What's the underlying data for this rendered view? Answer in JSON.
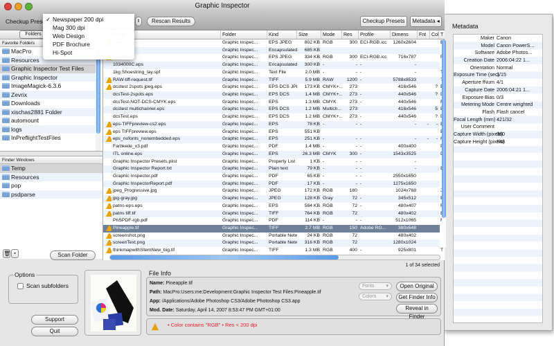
{
  "window": {
    "title": "Graphic Inspector"
  },
  "toolbar": {
    "preset_label": "Checkup Prese",
    "rescan": "Rescan Results",
    "checkup_presets": "Checkup Presets",
    "metadata": "Metadata"
  },
  "preset_menu": {
    "checkmark": "✓",
    "items": [
      "Newspaper 200 dpi",
      "Mag 300 dpi",
      "Web Design",
      "PDF Brochure",
      "Hi-Spot"
    ],
    "selected": "Newspaper 200 dpi"
  },
  "left": {
    "folders_tab": "Folders",
    "favorites_header": "Favorite Folders",
    "favorites": [
      "MacPro",
      "Resources",
      "Graphic Inspector Test Files",
      "Graphic Inspector",
      "ImageMagick-6.3.6",
      "Zevrix",
      "Downloads",
      "xischas2881 Folder",
      "automount",
      "logs",
      "InPreflightTestFiles"
    ],
    "favorites_selected": "Graphic Inspector Test Files",
    "finder_header": "Finder Windows",
    "finder": [
      "Temp",
      "Resources",
      "pop",
      "psdparse"
    ],
    "finder_selected": "Temp",
    "scan_folder": "Scan Folder"
  },
  "table": {
    "columns": [
      "",
      "Name",
      "Folder",
      "Kind",
      "Size",
      "Mode",
      "Res",
      "Profile",
      "Dimens",
      "Fnt",
      "Col",
      "T"
    ],
    "rows": [
      {
        "warn": true,
        "name": "...eps",
        "folder": "Graphic Inspec...",
        "kind": "EPS JPEG",
        "size": "802 KB",
        "mode": "RGB",
        "res": "300",
        "profile": "ECI-RGB.icc",
        "dim": "1260x2604",
        "fnt": "",
        "col": "",
        "t": "E"
      },
      {
        "warn": false,
        "name": "",
        "folder": "Graphic Inspec...",
        "kind": "Encapsulated P...",
        "size": "685 KB",
        "mode": "",
        "res": "",
        "profile": "",
        "dim": "",
        "fnt": "",
        "col": "",
        "t": ""
      },
      {
        "warn": true,
        "name": "...test.eps",
        "folder": "Graphic Inspec...",
        "kind": "EPS JPEG",
        "size": "334 KB",
        "mode": "RGB",
        "res": "300",
        "profile": "ECI-RGB.icc",
        "dim": "716x787",
        "fnt": "",
        "col": "",
        "t": "F"
      },
      {
        "warn": false,
        "name": "1034000C.eps",
        "folder": "Graphic Inspec...",
        "kind": "Encapsulated P...",
        "size": "300 KB",
        "mode": "-",
        "res": "-",
        "profile": "-",
        "dim": "-",
        "fnt": "",
        "col": "",
        "t": ""
      },
      {
        "warn": false,
        "name": "1kg Shoestring_lay.spf",
        "folder": "Graphic Inspec...",
        "kind": "Text File",
        "size": "2.0 MB",
        "mode": "-",
        "res": "-",
        "profile": "-",
        "dim": "-",
        "fnt": "",
        "col": "",
        "t": "T"
      },
      {
        "warn": true,
        "name": "RAW-tiff-request.tif",
        "folder": "Graphic Inspec...",
        "kind": "TIFF",
        "size": "5.9 MB",
        "mode": "RAW",
        "res": "1200",
        "profile": "-",
        "dim": "5788x8533",
        "fnt": "",
        "col": "",
        "t": "T"
      },
      {
        "warn": true,
        "name": "dcstest 2spots jpeg.eps",
        "folder": "Graphic Inspec...",
        "kind": "EPS DCS JPEG",
        "size": "173 KB",
        "mode": "CMYK+...",
        "res": "273",
        "profile": "",
        "dim": "416x546",
        "fnt": "",
        "col": "?",
        "t": "E"
      },
      {
        "warn": false,
        "name": "dcsTest-2spots.eps",
        "folder": "Graphic Inspec...",
        "kind": "EPS DCS",
        "size": "1.4 MB",
        "mode": "CMYK+...",
        "res": "273",
        "profile": "-",
        "dim": "440x546",
        "fnt": "",
        "col": "?",
        "t": "D"
      },
      {
        "warn": false,
        "name": "dcsTest-NOT-DCS-CMYK.eps",
        "folder": "Graphic Inspec...",
        "kind": "EPS",
        "size": "1.3 MB",
        "mode": "CMYK",
        "res": "273",
        "profile": "-",
        "dim": "440x546",
        "fnt": "",
        "col": "",
        "t": "F"
      },
      {
        "warn": false,
        "name": "dcstest multichannel.eps",
        "folder": "Graphic Inspec...",
        "kind": "EPS DCS",
        "size": "1.2 MB",
        "mode": "Multich...",
        "res": "273",
        "profile": "",
        "dim": "416x546",
        "fnt": "",
        "col": "5",
        "t": "E"
      },
      {
        "warn": false,
        "name": "dcsTest.eps",
        "folder": "Graphic Inspec...",
        "kind": "EPS DCS",
        "size": "1.2 MB",
        "mode": "CMYK+...",
        "res": "273",
        "profile": "-",
        "dim": "440x546",
        "fnt": "",
        "col": "?",
        "t": "D"
      },
      {
        "warn": true,
        "name": "eps-TIFFpreview-cs2.eps",
        "folder": "Graphic Inspec...",
        "kind": "EPS",
        "size": "78 KB",
        "mode": "-",
        "res": "-",
        "profile": "-",
        "dim": "-",
        "fnt": "-",
        "col": "-",
        "t": "E"
      },
      {
        "warn": true,
        "name": "eps TIFFpreview.eps",
        "folder": "Graphic Inspec...",
        "kind": "EPS",
        "size": "551 KB",
        "mode": "",
        "res": "",
        "profile": "",
        "dim": "",
        "fnt": "",
        "col": "",
        "t": "E"
      },
      {
        "warn": true,
        "name": "eps_nofonts_nonembedded.eps",
        "folder": "Graphic Inspec...",
        "kind": "EPS",
        "size": "251 KB",
        "mode": "-",
        "res": "-",
        "profile": "-",
        "dim": "-",
        "fnt": "-",
        "col": "-",
        "t": "F"
      },
      {
        "warn": false,
        "name": "Farbkeile_x3.pdf",
        "folder": "Graphic Inspec...",
        "kind": "PDF",
        "size": "1.4 MB",
        "mode": "-",
        "res": "-",
        "profile": "-",
        "dim": "400x400",
        "fnt": "",
        "col": "",
        "t": "P"
      },
      {
        "warn": false,
        "name": "ITL online.eps",
        "folder": "Graphic Inspec...",
        "kind": "EPS",
        "size": "26.3 MB",
        "mode": "CMYK",
        "res": "300",
        "profile": "-",
        "dim": "1543x3525",
        "fnt": "",
        "col": "",
        "t": "D"
      },
      {
        "warn": false,
        "name": "Graphic Inspector Presets.plist",
        "folder": "Graphic Inspec...",
        "kind": "Property List",
        "size": "1 KB",
        "mode": "-",
        "res": "-",
        "profile": "-",
        "dim": "-",
        "fnt": "",
        "col": "",
        "t": ""
      },
      {
        "warn": false,
        "name": "Graphic Inspector Report.txt",
        "folder": "Graphic Inspec...",
        "kind": "Plain text",
        "size": "79 KB",
        "mode": "-",
        "res": "-",
        "profile": "-",
        "dim": "-",
        "fnt": "",
        "col": "",
        "t": "E"
      },
      {
        "warn": false,
        "name": "Graphic Inspector.pdf",
        "folder": "Graphic Inspec...",
        "kind": "PDF",
        "size": "65 KB",
        "mode": "-",
        "res": "-",
        "profile": "-",
        "dim": "2550x1650",
        "fnt": "",
        "col": "",
        "t": ""
      },
      {
        "warn": false,
        "name": "Graphic InspectorReport.pdf",
        "folder": "Graphic Inspec...",
        "kind": "PDF",
        "size": "17 KB",
        "mode": "-",
        "res": "-",
        "profile": "-",
        "dim": "1275x1650",
        "fnt": "",
        "col": "",
        "t": ""
      },
      {
        "warn": true,
        "name": "jpeg_Progressive.jpg",
        "folder": "Graphic Inspec...",
        "kind": "JPEG",
        "size": "172 KB",
        "mode": "RGB",
        "res": "180",
        "profile": "",
        "dim": "1024x768",
        "fnt": "",
        "col": "",
        "t": "J"
      },
      {
        "warn": true,
        "name": "jpg-gray.jpg",
        "folder": "Graphic Inspec...",
        "kind": "JPEG",
        "size": "128 KB",
        "mode": "Gray",
        "res": "72",
        "profile": "-",
        "dim": "345x512",
        "fnt": "",
        "col": "",
        "t": "E"
      },
      {
        "warn": true,
        "name": "patns-eps.eps",
        "folder": "Graphic Inspec...",
        "kind": "EPS",
        "size": "584 KB",
        "mode": "RGB",
        "res": "72",
        "profile": "-",
        "dim": "480x407",
        "fnt": "",
        "col": "",
        "t": "F"
      },
      {
        "warn": true,
        "name": "patns tiff.tif",
        "folder": "Graphic Inspec...",
        "kind": "TIFF",
        "size": "764 KB",
        "mode": "RGB",
        "res": "72",
        "profile": "",
        "dim": "480x402",
        "fnt": "",
        "col": "",
        "t": "E"
      },
      {
        "warn": false,
        "name": "PhSPDF-rgb.pdf",
        "folder": "Graphic Inspec...",
        "kind": "PDF",
        "size": "114 KB",
        "mode": "-",
        "res": "-",
        "profile": "-",
        "dim": "512x1065",
        "fnt": "",
        "col": "",
        "t": "F"
      },
      {
        "warn": true,
        "name": "Pineapple.tif",
        "folder": "Graphic Inspec...",
        "kind": "TIFF",
        "size": "2.7 MB",
        "mode": "RGB",
        "res": "150",
        "profile": "Adobe RG...",
        "dim": "380x648",
        "fnt": "",
        "col": "",
        "t": "T",
        "selected": true
      },
      {
        "warn": true,
        "name": "screenshot.png",
        "folder": "Graphic Inspec...",
        "kind": "Portable Netw...",
        "size": "24 KB",
        "mode": "RGB",
        "res": "72",
        "profile": "",
        "dim": "480x402",
        "fnt": "",
        "col": "",
        "t": ""
      },
      {
        "warn": true,
        "name": "screenText.png",
        "folder": "Graphic Inspec...",
        "kind": "Portable Netw...",
        "size": "316 KB",
        "mode": "RGB",
        "res": "72",
        "profile": "",
        "dim": "1280x1024",
        "fnt": "",
        "col": "",
        "t": ""
      },
      {
        "warn": true,
        "name": "thinkmapwithStemNew_big.tif",
        "folder": "Graphic Inspec...",
        "kind": "TIFF",
        "size": "1.3 MB",
        "mode": "RGB",
        "res": "400",
        "profile": "-",
        "dim": "925x801",
        "fnt": "",
        "col": "",
        "t": "T"
      }
    ],
    "selection_status": "1 of 34 selected"
  },
  "options": {
    "title": "Options",
    "scan_subfolders": "Scan subfolders",
    "scan_subfolders_checked": false
  },
  "support": "Support",
  "quit": "Quit",
  "file_info": {
    "title": "File Info",
    "name_label": "Name:",
    "name": "Pineapple.tif",
    "path_label": "Path:",
    "path": "MacPro:Users:me:Development:Graphic Inspector Test Files:Pineapple.tif",
    "app_label": "App:",
    "app": "/Applications/Adobe Photoshop CS3/Adobe Photoshop CS3.app",
    "date_label": "Mod. Date:",
    "date": "Saturday, April 14, 2007 8:53:47 PM GMT+01:00",
    "fonts": "Fonts",
    "colors": "Colors",
    "open_original": "Open Original",
    "get_finder_info": "Get Finder Info",
    "reveal_in_finder": "Reveal in Finder",
    "warning": "• Color contains \"RGB\" • Res < 200 dpi"
  },
  "metadata": {
    "title": "Metadata",
    "items": [
      {
        "k": "Maker",
        "v": "Canon"
      },
      {
        "k": "Model",
        "v": "Canon PowerS..."
      },
      {
        "k": "Software",
        "v": "Adobe Photos..."
      },
      {
        "k": "Creation Date",
        "v": "2006:04:22 1..."
      },
      {
        "k": "Orientation",
        "v": "Normal"
      },
      {
        "k": "Exposure Time (sec)",
        "v": "1/15"
      },
      {
        "k": "Aperture fNum",
        "v": "4/1"
      },
      {
        "k": "Capture Date",
        "v": "2006:04:21 1..."
      },
      {
        "k": "Exposure Bias",
        "v": "0/3"
      },
      {
        "k": "Metering Mode",
        "v": "Centre weighted"
      },
      {
        "k": "Flash",
        "v": "Flash cancel"
      },
      {
        "k": "Focal Length (mm)",
        "v": "421/32"
      },
      {
        "k": "User Comment",
        "v": ""
      },
      {
        "k": "Capture Width (pixels)",
        "v": "380"
      },
      {
        "k": "Capture Height (pixels)",
        "v": "648"
      }
    ]
  },
  "colors": {
    "selection": "#6f8099",
    "stripe": "#edf3fd",
    "warning": "#e9a300",
    "error_text": "#e8202a",
    "scroll_thumb": "#5b9be6"
  }
}
